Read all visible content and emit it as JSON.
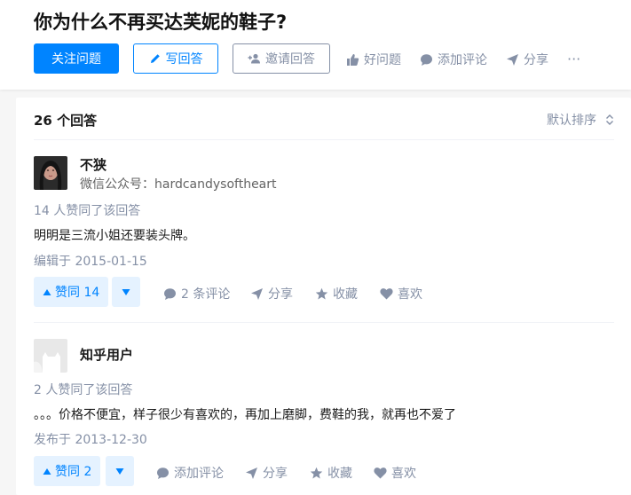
{
  "question": {
    "title": "你为什么不再买达芙妮的鞋子?",
    "actions": {
      "follow": "关注问题",
      "write": "写回答",
      "invite": "邀请回答",
      "good_question": "好问题",
      "add_comment": "添加评论",
      "share": "分享",
      "more": "···"
    }
  },
  "answers_header": {
    "count_label": "26 个回答",
    "sort_label": "默认排序"
  },
  "answers": [
    {
      "author": "不狭",
      "headline": "微信公众号：hardcandysoftheart",
      "voters": "14 人赞同了该回答",
      "content": "明明是三流小姐还要装头牌。",
      "date": "编辑于 2015-01-15",
      "vote_label": "赞同 14",
      "comments_label": "2 条评论",
      "share_label": "分享",
      "collect_label": "收藏",
      "like_label": "喜欢"
    },
    {
      "author": "知乎用户",
      "headline": "",
      "voters": "2 人赞同了该回答",
      "content": "。。。价格不便宜，样子很少有喜欢的，再加上磨脚，费鞋的我，就再也不爱了",
      "date": "发布于 2013-12-30",
      "vote_label": "赞同 2",
      "comments_label": "添加评论",
      "share_label": "分享",
      "collect_label": "收藏",
      "like_label": "喜欢"
    }
  ],
  "colors": {
    "brand": "#0084ff",
    "muted": "#8590a6",
    "vote_bg": "#e5f2ff"
  }
}
